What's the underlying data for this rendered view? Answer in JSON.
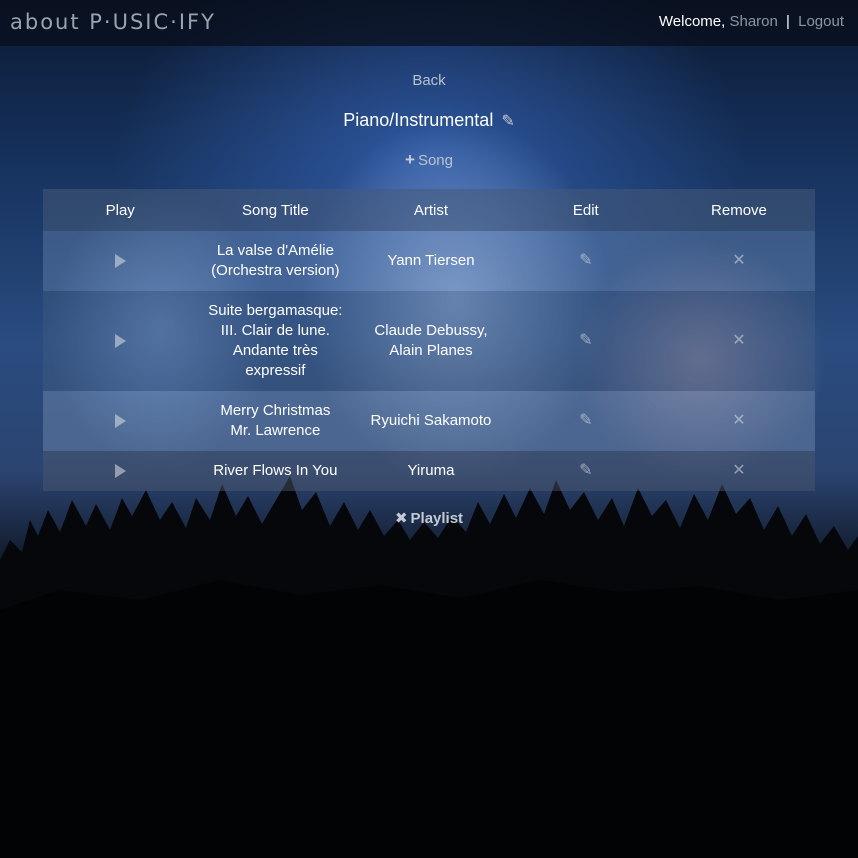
{
  "header": {
    "brand": "about P·USIC·IFY",
    "welcome": "Welcome,",
    "username": "Sharon",
    "separator": "|",
    "logout": "Logout"
  },
  "nav": {
    "back": "Back"
  },
  "playlist": {
    "title": "Piano/Instrumental",
    "add_song_label": "Song",
    "delete_playlist_label": "Playlist"
  },
  "table": {
    "headers": [
      "Play",
      "Song Title",
      "Artist",
      "Edit",
      "Remove"
    ],
    "rows": [
      {
        "title_lines": [
          "La valse d'Amélie",
          "(Orchestra version)"
        ],
        "artist_lines": [
          "Yann Tiersen"
        ]
      },
      {
        "title_lines": [
          "Suite bergamasque:",
          "III. Clair de lune.",
          "Andante très",
          "expressif"
        ],
        "artist_lines": [
          "Claude Debussy,",
          "Alain Planes"
        ]
      },
      {
        "title_lines": [
          "Merry Christmas",
          "Mr. Lawrence"
        ],
        "artist_lines": [
          "Ryuichi Sakamoto"
        ]
      },
      {
        "title_lines": [
          "River Flows In You"
        ],
        "artist_lines": [
          "Yiruma"
        ]
      }
    ]
  },
  "icons": {
    "play": "play-icon",
    "edit": "pencil-icon",
    "remove": "close-icon",
    "add": "plus-icon"
  }
}
